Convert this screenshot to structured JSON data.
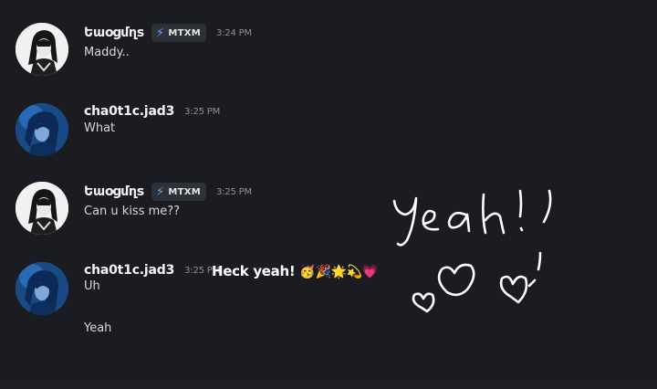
{
  "messages": [
    {
      "username": "Եաօցմղs",
      "tag": "MTXM",
      "time": "3:24 PM",
      "content": "Maddy.."
    },
    {
      "username": "cha0t1c.jad3",
      "time": "3:25 PM",
      "content": "What"
    },
    {
      "username": "Եաօցմղs",
      "tag": "MTXM",
      "time": "3:25 PM",
      "content": "Can u kiss me??"
    },
    {
      "username": "cha0t1c.jad3",
      "time": "3:25 PM",
      "content": "Uh",
      "followup": "Yeah"
    }
  ],
  "overlay": {
    "caption": "Heck yeah!",
    "caption_emoji": "🥳🎉🌟💫💗",
    "handwriting": "Yeah!"
  },
  "colors": {
    "background": "#1b1c21",
    "tag_bolt": "#5aa9ff",
    "timestamp": "#8e9199"
  },
  "icons": [
    "bolt-icon",
    "heart-scribble"
  ]
}
